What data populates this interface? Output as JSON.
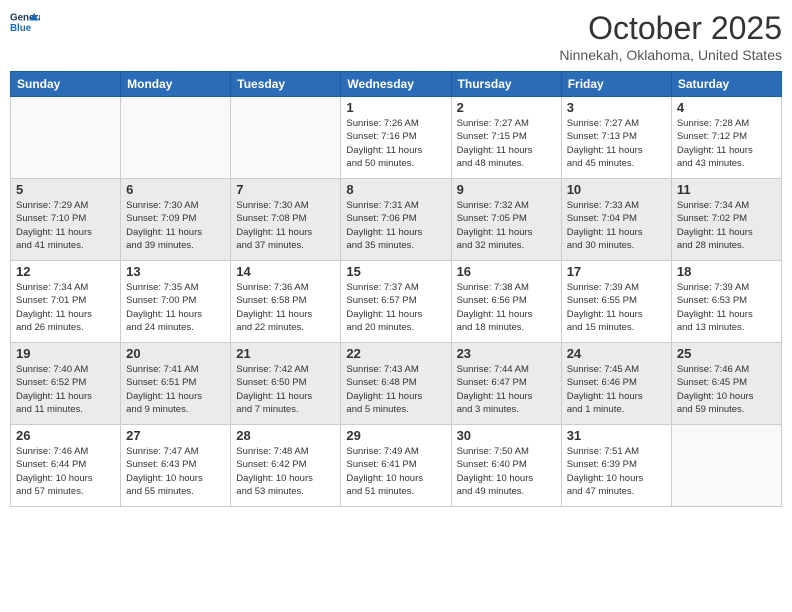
{
  "header": {
    "logo_text": "General Blue",
    "month": "October 2025",
    "location": "Ninnekah, Oklahoma, United States"
  },
  "weekdays": [
    "Sunday",
    "Monday",
    "Tuesday",
    "Wednesday",
    "Thursday",
    "Friday",
    "Saturday"
  ],
  "weeks": [
    [
      {
        "day": "",
        "info": ""
      },
      {
        "day": "",
        "info": ""
      },
      {
        "day": "",
        "info": ""
      },
      {
        "day": "1",
        "info": "Sunrise: 7:26 AM\nSunset: 7:16 PM\nDaylight: 11 hours\nand 50 minutes."
      },
      {
        "day": "2",
        "info": "Sunrise: 7:27 AM\nSunset: 7:15 PM\nDaylight: 11 hours\nand 48 minutes."
      },
      {
        "day": "3",
        "info": "Sunrise: 7:27 AM\nSunset: 7:13 PM\nDaylight: 11 hours\nand 45 minutes."
      },
      {
        "day": "4",
        "info": "Sunrise: 7:28 AM\nSunset: 7:12 PM\nDaylight: 11 hours\nand 43 minutes."
      }
    ],
    [
      {
        "day": "5",
        "info": "Sunrise: 7:29 AM\nSunset: 7:10 PM\nDaylight: 11 hours\nand 41 minutes."
      },
      {
        "day": "6",
        "info": "Sunrise: 7:30 AM\nSunset: 7:09 PM\nDaylight: 11 hours\nand 39 minutes."
      },
      {
        "day": "7",
        "info": "Sunrise: 7:30 AM\nSunset: 7:08 PM\nDaylight: 11 hours\nand 37 minutes."
      },
      {
        "day": "8",
        "info": "Sunrise: 7:31 AM\nSunset: 7:06 PM\nDaylight: 11 hours\nand 35 minutes."
      },
      {
        "day": "9",
        "info": "Sunrise: 7:32 AM\nSunset: 7:05 PM\nDaylight: 11 hours\nand 32 minutes."
      },
      {
        "day": "10",
        "info": "Sunrise: 7:33 AM\nSunset: 7:04 PM\nDaylight: 11 hours\nand 30 minutes."
      },
      {
        "day": "11",
        "info": "Sunrise: 7:34 AM\nSunset: 7:02 PM\nDaylight: 11 hours\nand 28 minutes."
      }
    ],
    [
      {
        "day": "12",
        "info": "Sunrise: 7:34 AM\nSunset: 7:01 PM\nDaylight: 11 hours\nand 26 minutes."
      },
      {
        "day": "13",
        "info": "Sunrise: 7:35 AM\nSunset: 7:00 PM\nDaylight: 11 hours\nand 24 minutes."
      },
      {
        "day": "14",
        "info": "Sunrise: 7:36 AM\nSunset: 6:58 PM\nDaylight: 11 hours\nand 22 minutes."
      },
      {
        "day": "15",
        "info": "Sunrise: 7:37 AM\nSunset: 6:57 PM\nDaylight: 11 hours\nand 20 minutes."
      },
      {
        "day": "16",
        "info": "Sunrise: 7:38 AM\nSunset: 6:56 PM\nDaylight: 11 hours\nand 18 minutes."
      },
      {
        "day": "17",
        "info": "Sunrise: 7:39 AM\nSunset: 6:55 PM\nDaylight: 11 hours\nand 15 minutes."
      },
      {
        "day": "18",
        "info": "Sunrise: 7:39 AM\nSunset: 6:53 PM\nDaylight: 11 hours\nand 13 minutes."
      }
    ],
    [
      {
        "day": "19",
        "info": "Sunrise: 7:40 AM\nSunset: 6:52 PM\nDaylight: 11 hours\nand 11 minutes."
      },
      {
        "day": "20",
        "info": "Sunrise: 7:41 AM\nSunset: 6:51 PM\nDaylight: 11 hours\nand 9 minutes."
      },
      {
        "day": "21",
        "info": "Sunrise: 7:42 AM\nSunset: 6:50 PM\nDaylight: 11 hours\nand 7 minutes."
      },
      {
        "day": "22",
        "info": "Sunrise: 7:43 AM\nSunset: 6:48 PM\nDaylight: 11 hours\nand 5 minutes."
      },
      {
        "day": "23",
        "info": "Sunrise: 7:44 AM\nSunset: 6:47 PM\nDaylight: 11 hours\nand 3 minutes."
      },
      {
        "day": "24",
        "info": "Sunrise: 7:45 AM\nSunset: 6:46 PM\nDaylight: 11 hours\nand 1 minute."
      },
      {
        "day": "25",
        "info": "Sunrise: 7:46 AM\nSunset: 6:45 PM\nDaylight: 10 hours\nand 59 minutes."
      }
    ],
    [
      {
        "day": "26",
        "info": "Sunrise: 7:46 AM\nSunset: 6:44 PM\nDaylight: 10 hours\nand 57 minutes."
      },
      {
        "day": "27",
        "info": "Sunrise: 7:47 AM\nSunset: 6:43 PM\nDaylight: 10 hours\nand 55 minutes."
      },
      {
        "day": "28",
        "info": "Sunrise: 7:48 AM\nSunset: 6:42 PM\nDaylight: 10 hours\nand 53 minutes."
      },
      {
        "day": "29",
        "info": "Sunrise: 7:49 AM\nSunset: 6:41 PM\nDaylight: 10 hours\nand 51 minutes."
      },
      {
        "day": "30",
        "info": "Sunrise: 7:50 AM\nSunset: 6:40 PM\nDaylight: 10 hours\nand 49 minutes."
      },
      {
        "day": "31",
        "info": "Sunrise: 7:51 AM\nSunset: 6:39 PM\nDaylight: 10 hours\nand 47 minutes."
      },
      {
        "day": "",
        "info": ""
      }
    ]
  ]
}
